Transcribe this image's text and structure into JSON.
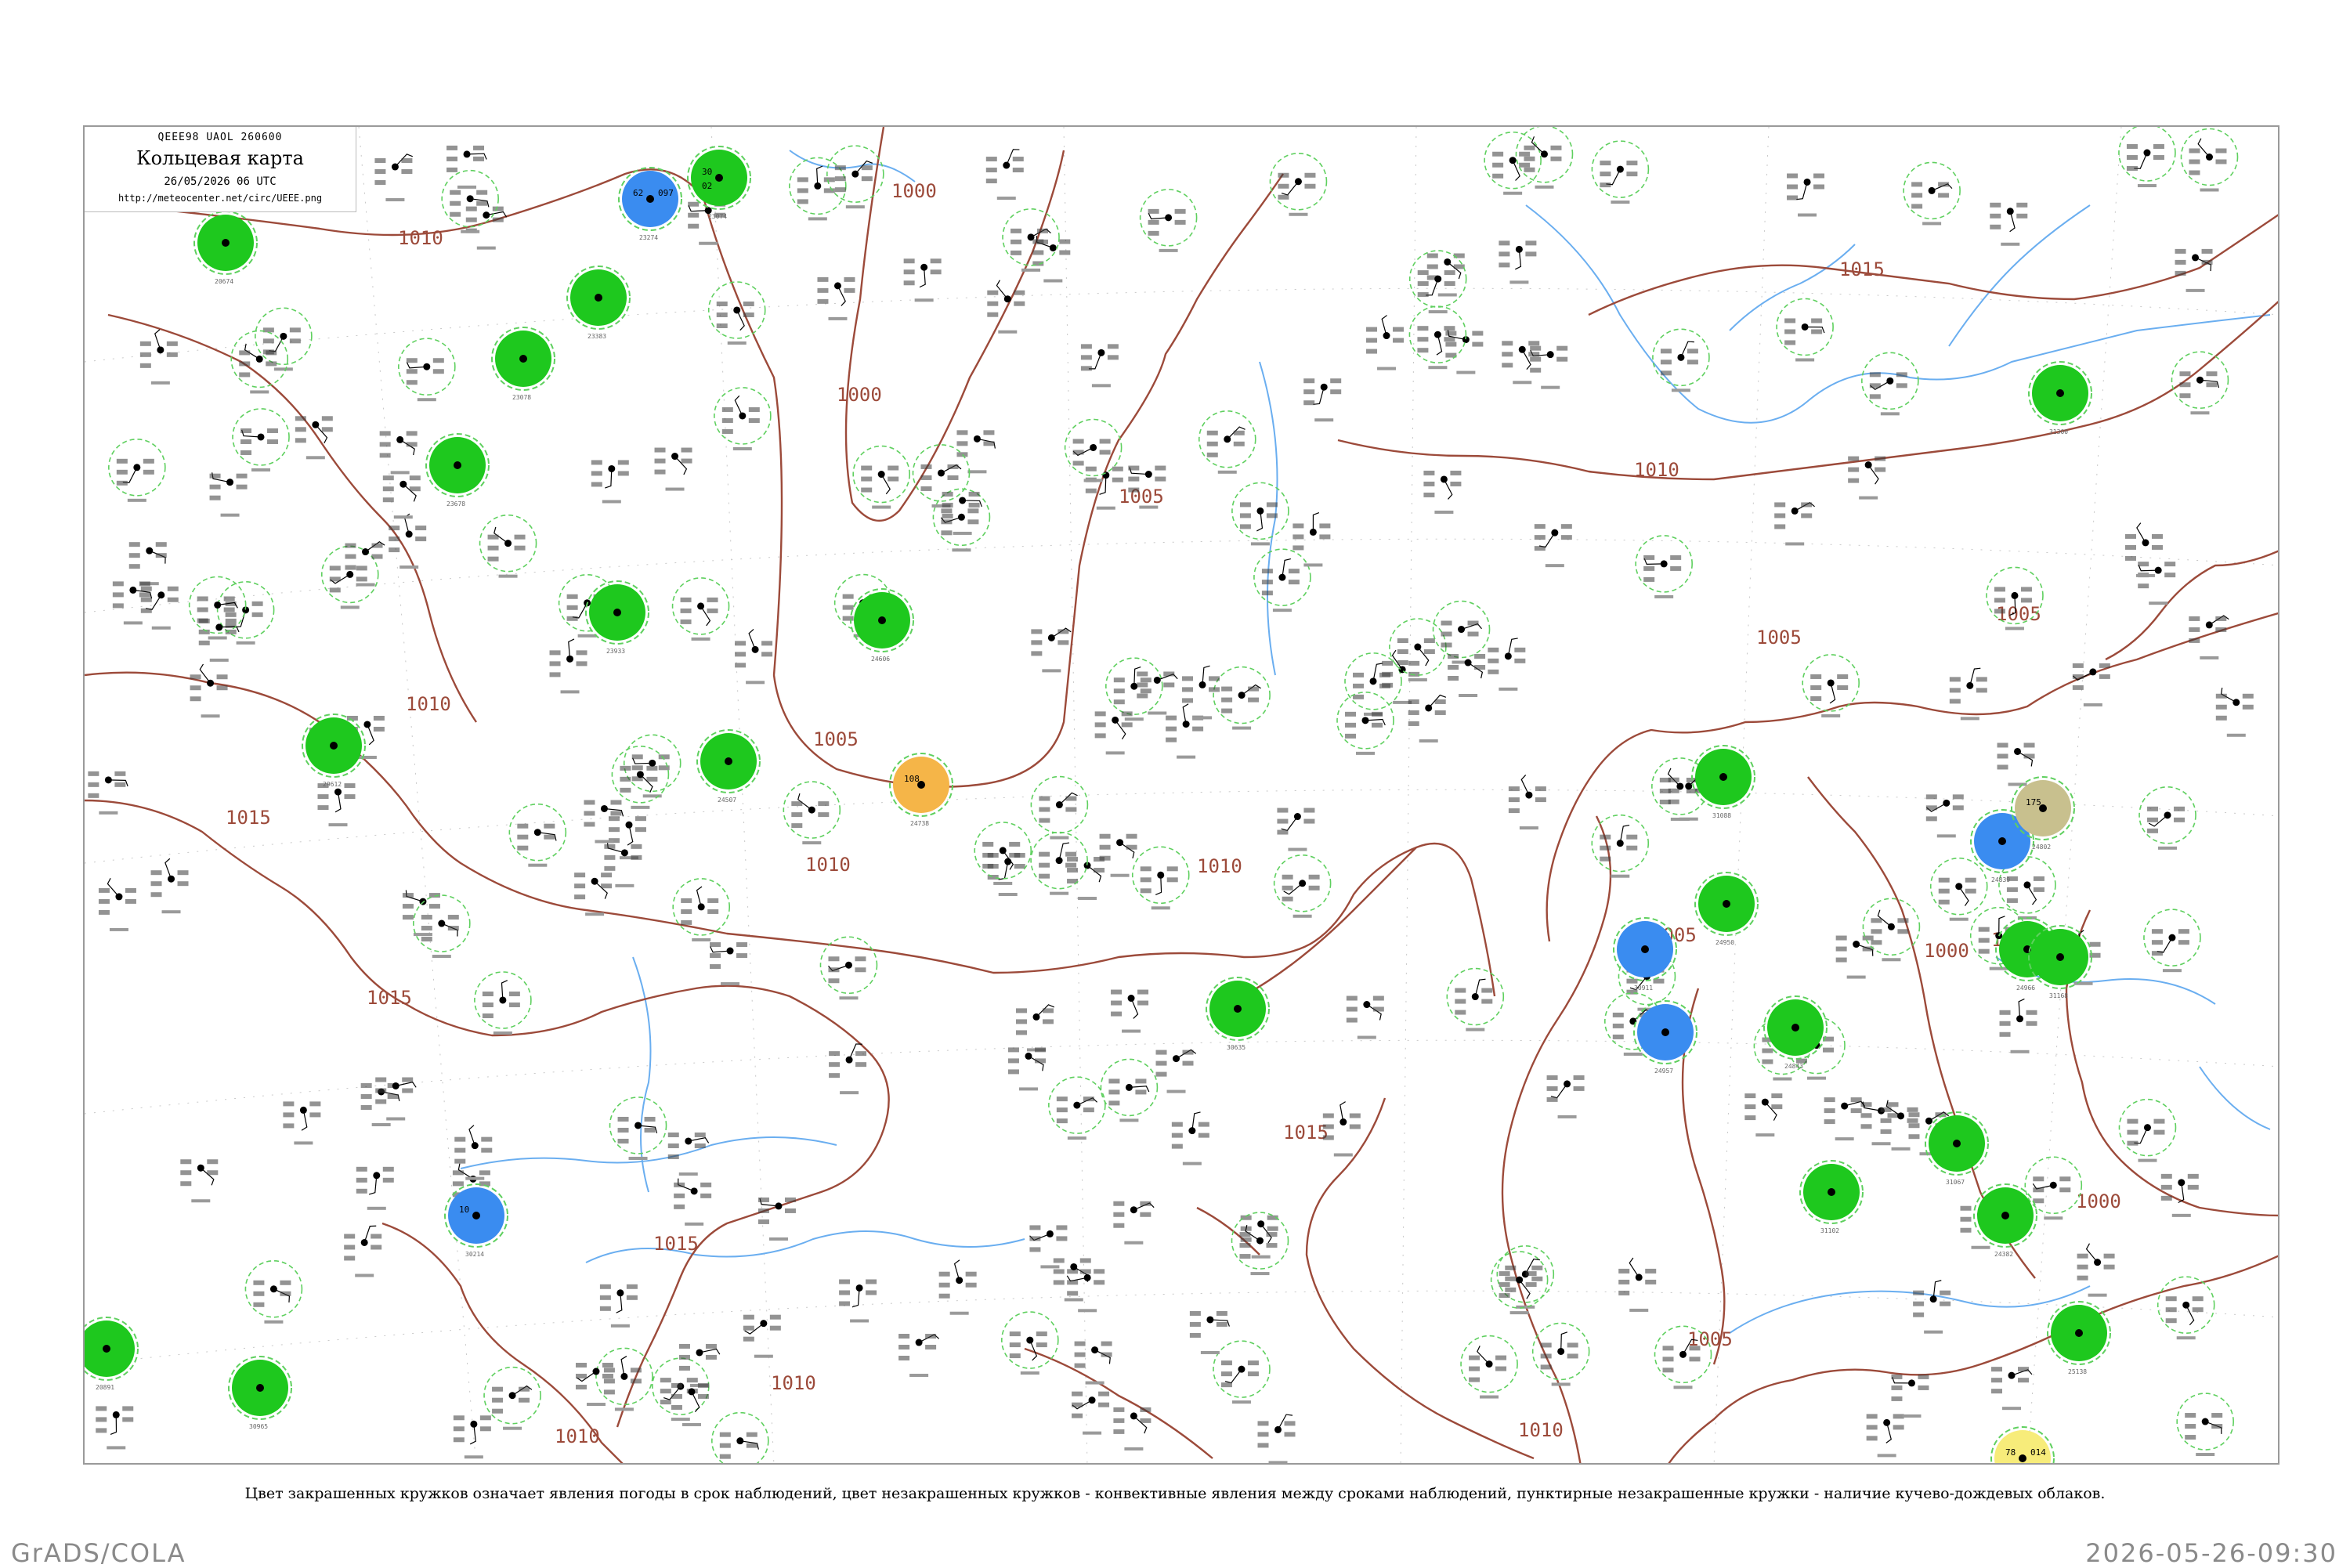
{
  "header": {
    "code": "QEEE98  UAOL  260600",
    "title": "Кольцевая карта",
    "date": "26/05/2026 06 UTC",
    "url": "http://meteocenter.net/circ/UEEE.png"
  },
  "caption": "Цвет закрашенных кружков означает явления погоды в срок наблюдений, цвет незакрашенных кружков - конвективные явления между сроками наблюдений, пунктирные незакрашенные кружки - наличие кучево-дождевых облаков.",
  "footer": {
    "left": "GrADS/COLA",
    "right": "2026-05-26-09:30"
  },
  "colors": {
    "isobar": "#9c4a3a",
    "river": "#6aaef0",
    "fill_green": "#1ec81e",
    "fill_blue": "#3a8cf0",
    "fill_orange": "#f5b548",
    "fill_yellow": "#f7ec7a",
    "fill_khaki": "#c8c08e",
    "ring_green": "#28c828",
    "ring_green_dashed": "#5fd05f"
  },
  "isobar_labels": [
    {
      "text": "1010"
    },
    {
      "text": "1000"
    },
    {
      "text": "1000"
    },
    {
      "text": "1005"
    },
    {
      "text": "1015"
    },
    {
      "text": "1010"
    },
    {
      "text": "1005"
    },
    {
      "text": "1010"
    },
    {
      "text": "1010"
    },
    {
      "text": "1005"
    },
    {
      "text": "1015"
    },
    {
      "text": "1005"
    },
    {
      "text": "1000"
    },
    {
      "text": "1015"
    },
    {
      "text": "1010"
    },
    {
      "text": "1015"
    },
    {
      "text": "1010"
    },
    {
      "text": "1005"
    },
    {
      "text": "1010"
    },
    {
      "text": "1015"
    },
    {
      "text": "1005"
    },
    {
      "text": "1000"
    },
    {
      "text": "1005"
    },
    {
      "text": "1010"
    }
  ],
  "stations": [
    {
      "id": "23074",
      "t": "30",
      "p": "",
      "td": "02",
      "mark": "filled-green"
    },
    {
      "id": "23274",
      "t": "62",
      "p": "097",
      "td": "",
      "mark": "filled-blue"
    },
    {
      "id": "20674",
      "t": "",
      "p": "",
      "td": "",
      "mark": "filled-green"
    },
    {
      "id": "23383",
      "t": "",
      "p": "",
      "td": "",
      "mark": "filled-green"
    },
    {
      "id": "23078",
      "t": "",
      "p": "",
      "td": "",
      "mark": "filled-green"
    },
    {
      "id": "23678",
      "t": "",
      "p": "",
      "td": "",
      "mark": "filled-green"
    },
    {
      "id": "23933",
      "t": "",
      "p": "",
      "td": "",
      "mark": "filled-green"
    },
    {
      "id": "24606",
      "t": "",
      "p": "",
      "td": "",
      "mark": "filled-green"
    },
    {
      "id": "24507",
      "t": "",
      "p": "",
      "td": "",
      "mark": "filled-green"
    },
    {
      "id": "29612",
      "t": "",
      "p": "",
      "td": "",
      "mark": "filled-green"
    },
    {
      "id": "24738",
      "t": "108",
      "p": "",
      "td": "",
      "mark": "filled-orange"
    },
    {
      "id": "30635",
      "t": "",
      "p": "",
      "td": "",
      "mark": "filled-green"
    },
    {
      "id": "30965",
      "t": "",
      "p": "",
      "td": "",
      "mark": "filled-green"
    },
    {
      "id": "30214",
      "t": "10",
      "p": "",
      "td": "",
      "mark": "filled-blue"
    },
    {
      "id": "20891",
      "t": "",
      "p": "",
      "td": "",
      "mark": "filled-green"
    },
    {
      "id": "31088",
      "t": "",
      "p": "",
      "td": "",
      "mark": "filled-green"
    },
    {
      "id": "30911",
      "t": "",
      "p": "",
      "td": "",
      "mark": "filled-blue"
    },
    {
      "id": "24950",
      "t": "",
      "p": "",
      "td": "",
      "mark": "filled-green"
    },
    {
      "id": "24957",
      "t": "",
      "p": "",
      "td": "",
      "mark": "filled-blue"
    },
    {
      "id": "24843",
      "t": "",
      "p": "",
      "td": "",
      "mark": "filled-green"
    },
    {
      "id": "24839",
      "t": "",
      "p": "",
      "td": "",
      "mark": "filled-blue"
    },
    {
      "id": "24966",
      "t": "",
      "p": "",
      "td": "",
      "mark": "filled-green"
    },
    {
      "id": "31067",
      "t": "",
      "p": "",
      "td": "",
      "mark": "filled-green"
    },
    {
      "id": "24382",
      "t": "",
      "p": "",
      "td": "",
      "mark": "filled-green"
    },
    {
      "id": "24802",
      "t": "175",
      "p": "",
      "td": "",
      "mark": "filled-khaki"
    },
    {
      "id": "25138",
      "t": "",
      "p": "",
      "td": "",
      "mark": "filled-green"
    },
    {
      "id": "31102",
      "t": "",
      "p": "",
      "td": "",
      "mark": "filled-green"
    },
    {
      "id": "31168",
      "t": "",
      "p": "",
      "td": "",
      "mark": "filled-green"
    },
    {
      "id": "31300",
      "t": "",
      "p": "",
      "td": "",
      "mark": "filled-green"
    },
    {
      "id": "31416",
      "t": "78",
      "p": "014",
      "td": "",
      "mark": "filled-yellow"
    }
  ]
}
